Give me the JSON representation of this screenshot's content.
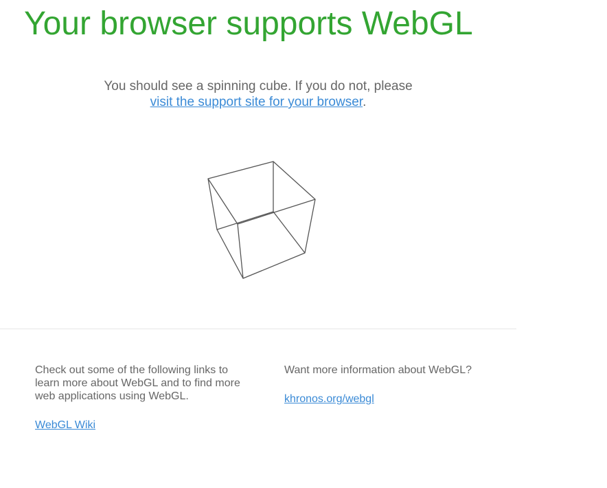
{
  "header": {
    "title": "Your browser supports WebGL"
  },
  "intro": {
    "text": "You should see a spinning cube. If you do not, please",
    "link_label": "visit the support site for your browser",
    "trailing": "."
  },
  "footer": {
    "left": {
      "text": "Check out some of the following links to learn more about WebGL and to find more web applications using WebGL.",
      "link_label": "WebGL Wiki"
    },
    "right": {
      "text": "Want more information about WebGL?",
      "link_label": "khronos.org/webgl"
    }
  },
  "colors": {
    "title": "#33a532",
    "link": "#3a8ad6",
    "text": "#666666",
    "cube_stroke": "#555555"
  }
}
